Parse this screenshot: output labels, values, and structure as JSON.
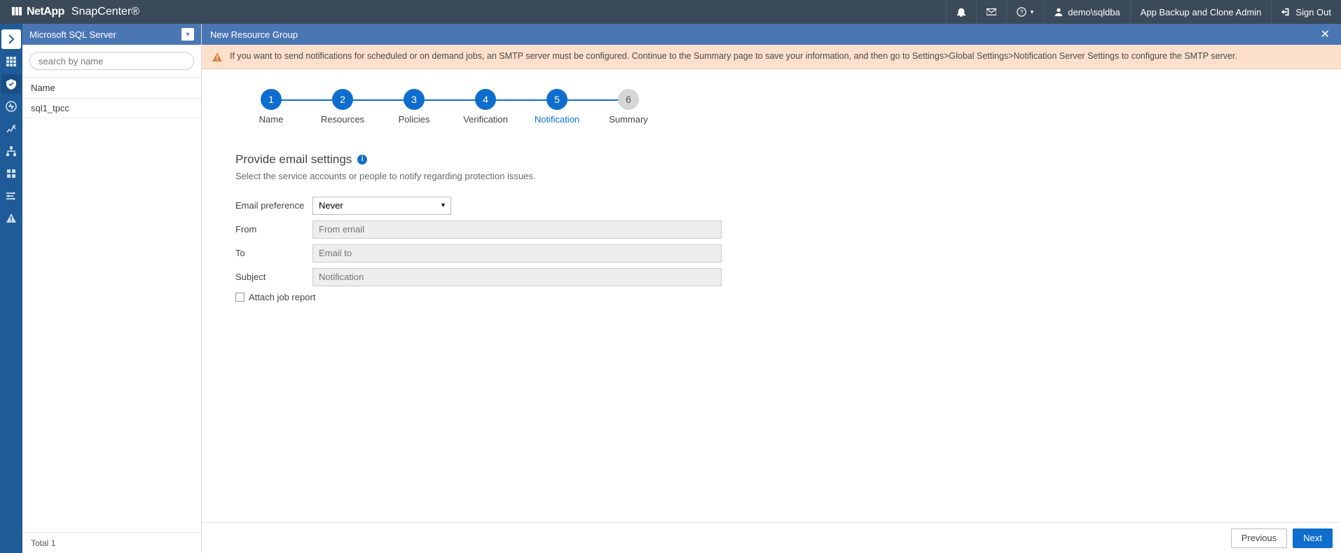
{
  "brand": {
    "company": "NetApp",
    "product": "SnapCenter®"
  },
  "topbar": {
    "user": "demo\\sqldba",
    "role": "App Backup and Clone Admin",
    "signout": "Sign Out"
  },
  "sidebar": {
    "header": "Microsoft SQL Server",
    "search_placeholder": "search by name",
    "column": "Name",
    "rows": [
      "sql1_tpcc"
    ],
    "footer_total_label": "Total",
    "footer_total_value": "1"
  },
  "main": {
    "title": "New Resource Group",
    "notice": "If you want to send notifications for scheduled or on demand jobs, an SMTP server must be configured. Continue to the Summary page to save your information, and then go to Settings>Global Settings>Notification Server Settings to configure the SMTP server.",
    "steps": [
      {
        "num": "1",
        "label": "Name"
      },
      {
        "num": "2",
        "label": "Resources"
      },
      {
        "num": "3",
        "label": "Policies"
      },
      {
        "num": "4",
        "label": "Verification"
      },
      {
        "num": "5",
        "label": "Notification"
      },
      {
        "num": "6",
        "label": "Summary"
      }
    ],
    "form": {
      "heading": "Provide email settings",
      "sub": "Select the service accounts or people to notify regarding protection issues.",
      "email_pref_label": "Email preference",
      "email_pref_value": "Never",
      "from_label": "From",
      "from_placeholder": "From email",
      "to_label": "To",
      "to_placeholder": "Email to",
      "subject_label": "Subject",
      "subject_placeholder": "Notification",
      "attach_label": "Attach job report"
    },
    "buttons": {
      "previous": "Previous",
      "next": "Next"
    }
  }
}
